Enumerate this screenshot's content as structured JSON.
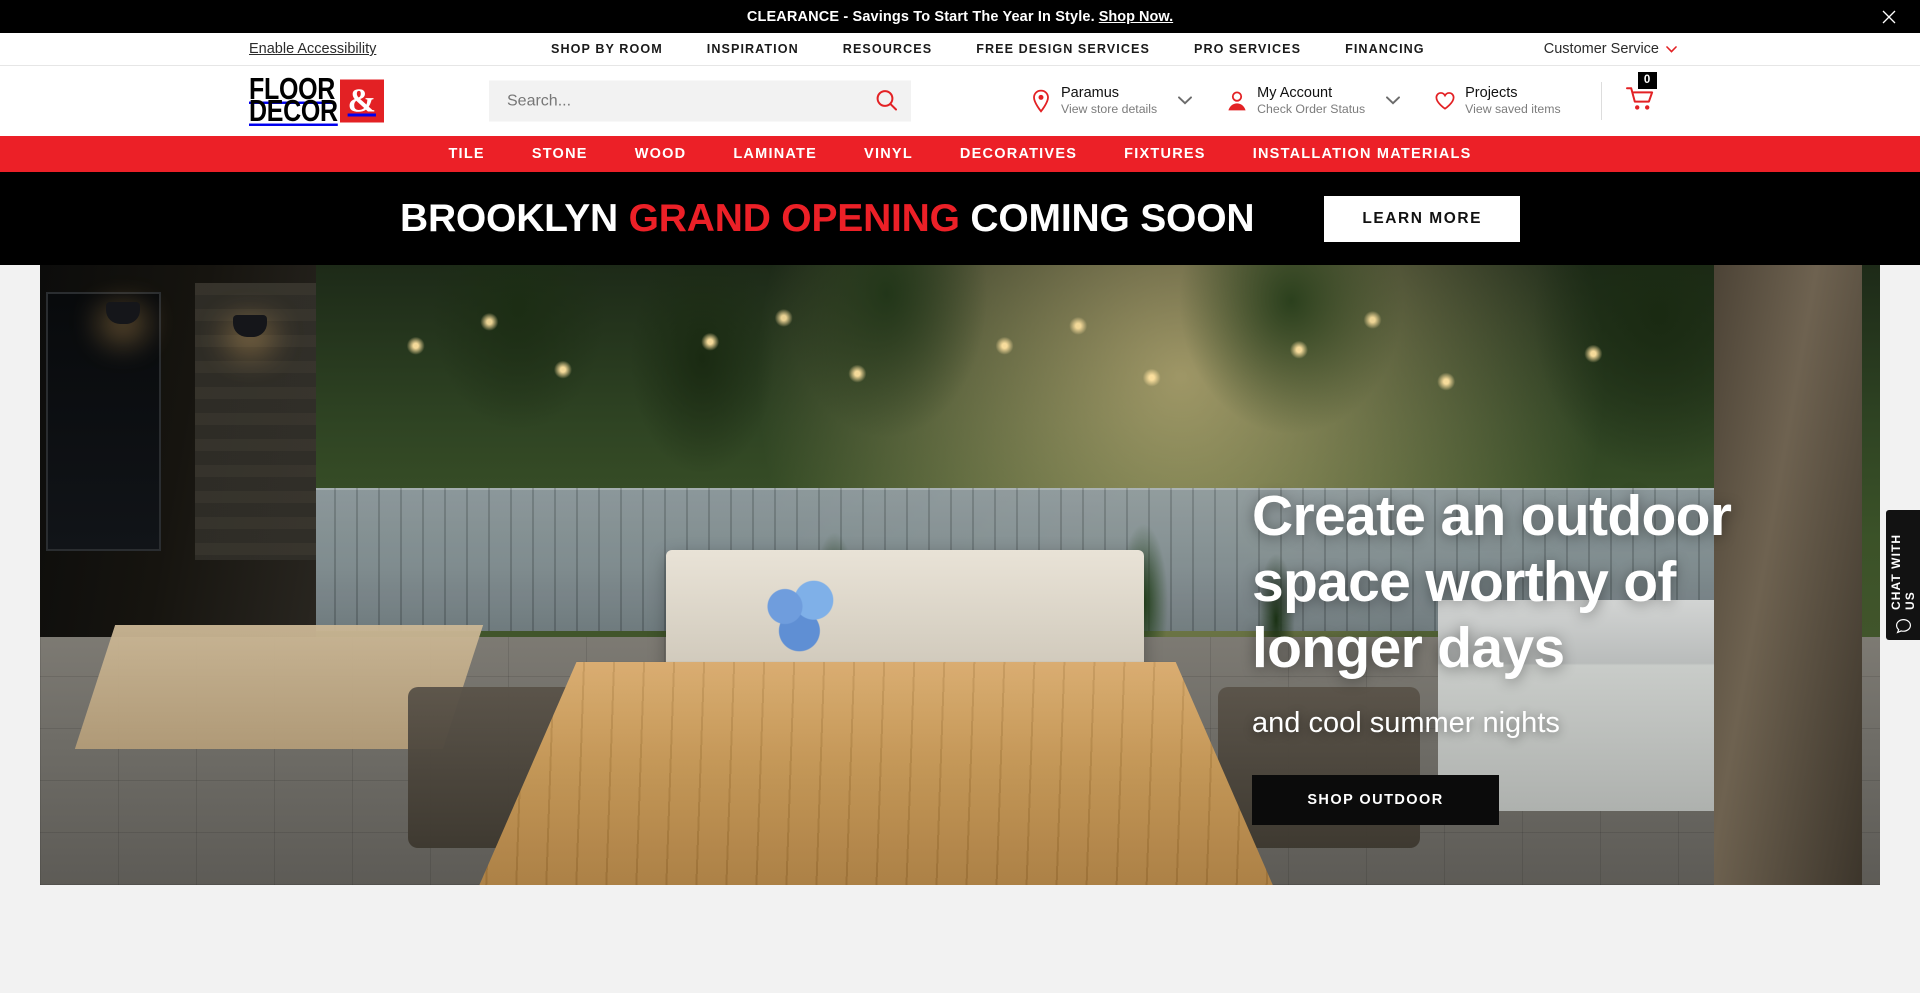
{
  "promo": {
    "text": "CLEARANCE - Savings To Start The Year In Style.",
    "link_label": "Shop Now.",
    "close_label": "Close",
    "background": "#000000"
  },
  "util_nav": {
    "accessibility_label": "Enable Accessibility",
    "links": [
      {
        "label": "SHOP BY ROOM"
      },
      {
        "label": "INSPIRATION"
      },
      {
        "label": "RESOURCES"
      },
      {
        "label": "FREE DESIGN SERVICES"
      },
      {
        "label": "PRO SERVICES"
      },
      {
        "label": "FINANCING"
      }
    ],
    "customer_service_label": "Customer Service"
  },
  "header": {
    "logo": {
      "line1": "FLOOR",
      "line2": "DECOR",
      "ampersand": "&",
      "accent": "#E32124"
    },
    "search": {
      "placeholder": "Search...",
      "value": ""
    },
    "store": {
      "title": "Paramus",
      "subtitle": "View store details"
    },
    "account": {
      "title": "My Account",
      "subtitle": "Check Order Status"
    },
    "projects": {
      "title": "Projects",
      "subtitle": "View saved items"
    },
    "cart": {
      "count": "0"
    }
  },
  "category_nav": {
    "background": "#EC2027",
    "items": [
      {
        "label": "TILE"
      },
      {
        "label": "STONE"
      },
      {
        "label": "WOOD"
      },
      {
        "label": "LAMINATE"
      },
      {
        "label": "VINYL"
      },
      {
        "label": "DECORATIVES"
      },
      {
        "label": "FIXTURES"
      },
      {
        "label": "INSTALLATION MATERIALS"
      }
    ]
  },
  "grand_opening": {
    "text_before": "BROOKLYN ",
    "highlight": "GRAND OPENING",
    "text_after": " COMING SOON",
    "button_label": "LEARN MORE",
    "highlight_color": "#EC2027"
  },
  "hero": {
    "title_line1": "Create an outdoor",
    "title_line2": "space worthy of",
    "title_line3": "longer days",
    "subtitle": "and cool summer nights",
    "button_label": "SHOP OUTDOOR"
  },
  "chat": {
    "label": "CHAT WITH US"
  }
}
